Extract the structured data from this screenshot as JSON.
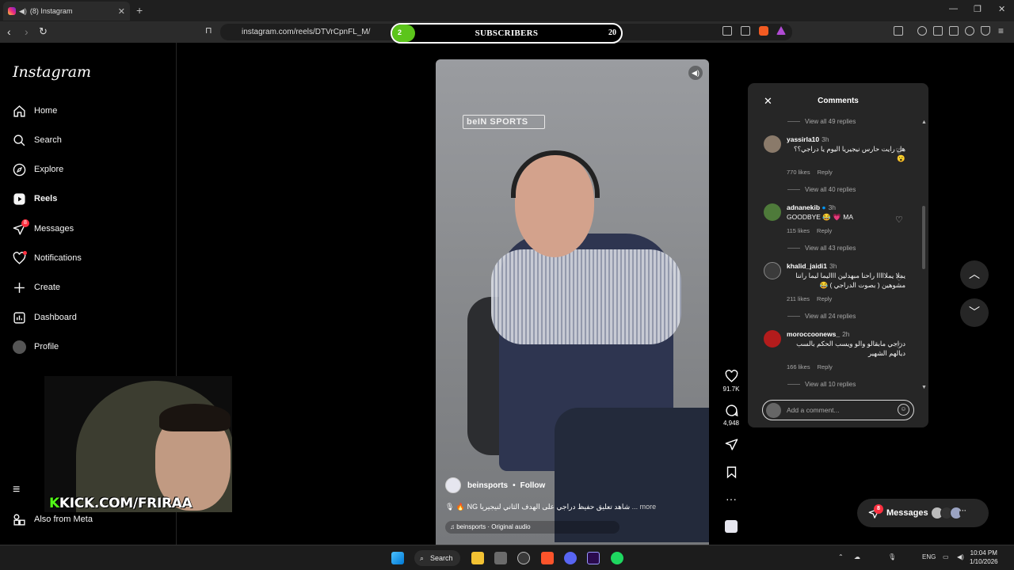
{
  "browser": {
    "tab_title": "(8) Instagram",
    "new_tab_glyph": "+",
    "url": "instagram.com/reels/DTVrCpnFL_M/",
    "window_controls": [
      "—",
      "❐",
      "✕"
    ]
  },
  "subscriber_bar": {
    "current": "2",
    "label": "SUBSCRIBERS",
    "goal": "20",
    "fill_fraction": 0.1,
    "color": "#5cc51b"
  },
  "sidebar": {
    "logo": "Instagram",
    "items": [
      {
        "label": "Home",
        "icon": "home-icon"
      },
      {
        "label": "Search",
        "icon": "search-icon"
      },
      {
        "label": "Explore",
        "icon": "compass-icon"
      },
      {
        "label": "Reels",
        "icon": "reels-icon"
      },
      {
        "label": "Messages",
        "icon": "send-icon",
        "badge": "8"
      },
      {
        "label": "Notifications",
        "icon": "heart-icon"
      },
      {
        "label": "Create",
        "icon": "plus-icon"
      },
      {
        "label": "Dashboard",
        "icon": "dashboard-icon"
      },
      {
        "label": "Profile",
        "icon": "profile-avatar"
      }
    ],
    "more_label": "≡",
    "meta_label": "Also from Meta"
  },
  "stream_overlay": {
    "kick_k": "K",
    "kick_text": "KICK.COM/FRIRAA",
    "kick_color": "#53fc18"
  },
  "reel": {
    "watermark": "beIN SPORTS",
    "author": "beinsports",
    "follow_label": "Follow",
    "caption": "🎙 🔥 NG شاهد تعليق حفيظ دراجي على الهدف الثاني لنيجيريا",
    "more_label": "... more",
    "audio": "beinsports · Original audio",
    "likes": "91.7K",
    "comments": "4,948"
  },
  "comments": {
    "title": "Comments",
    "top_view_replies": "View all 49 replies",
    "items": [
      {
        "user": "yassirla10",
        "time": "3h",
        "text": "هل رايت حارس نيجيريا اليوم يا دراجي؟؟ 😮",
        "likes": "770 likes",
        "reply": "Reply",
        "view_replies": "View all 40 replies",
        "rtl": true,
        "avatar_color": "#8a7a6a"
      },
      {
        "user": "adnanekib",
        "time": "3h",
        "text": "GOODBYE 😂 💗 MA",
        "likes": "115 likes",
        "reply": "Reply",
        "view_replies": "View all 43 replies",
        "rtl": false,
        "avatar_color": "#4e7a3a"
      },
      {
        "user": "khalid_jaidi1",
        "time": "3h",
        "text": "يملا يملااااا راحنا مبهدلين اااليما ليما راننا مشوهين ( بصوت الدراجي ) 😂",
        "likes": "211 likes",
        "reply": "Reply",
        "view_replies": "View all 24 replies",
        "rtl": true,
        "avatar_color": "#3b3b3b"
      },
      {
        "user": "moroccoonews_",
        "time": "2h",
        "text": "دراجي مابقالو والو ويسب الحكم بالسب ديالهم الشهير",
        "likes": "166 likes",
        "reply": "Reply",
        "view_replies": "View all 10 replies",
        "rtl": true,
        "avatar_color": "#b31c1c"
      }
    ],
    "input_placeholder": "Add a comment..."
  },
  "messages_pill": {
    "label": "Messages",
    "badge": "8"
  },
  "taskbar": {
    "search_label": "Search",
    "lang": "ENG",
    "time": "10:04 PM",
    "date": "1/10/2026"
  }
}
